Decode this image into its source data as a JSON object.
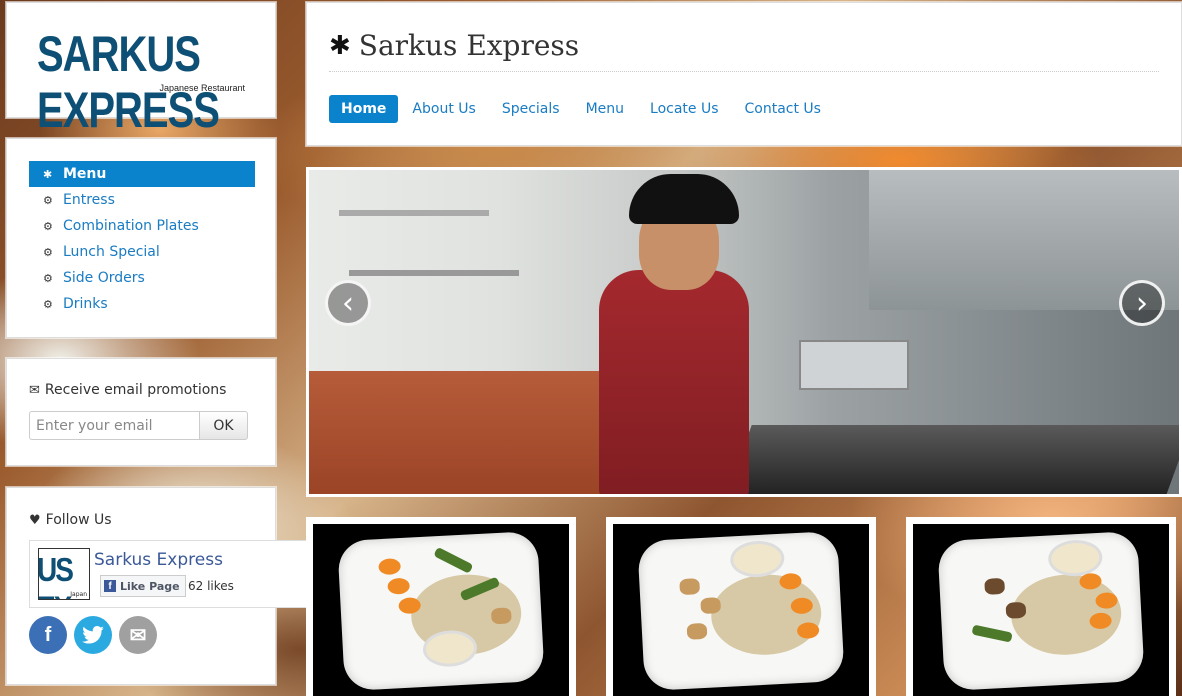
{
  "brand": {
    "logo_text": "SARKUS EXPRESS",
    "logo_subtitle": "Japanese Restaurant",
    "site_title": "Sarkus Express"
  },
  "nav": {
    "items": [
      {
        "label": "Home",
        "active": true
      },
      {
        "label": "About Us"
      },
      {
        "label": "Specials"
      },
      {
        "label": "Menu"
      },
      {
        "label": "Locate Us"
      },
      {
        "label": "Contact Us"
      }
    ]
  },
  "sidebar_menu": {
    "items": [
      {
        "label": "Menu",
        "icon": "asterisk-icon",
        "active": true
      },
      {
        "label": "Entress",
        "icon": "gear-icon"
      },
      {
        "label": "Combination Plates",
        "icon": "gear-icon"
      },
      {
        "label": "Lunch Special",
        "icon": "gear-icon"
      },
      {
        "label": "Side Orders",
        "icon": "gear-icon"
      },
      {
        "label": "Drinks",
        "icon": "gear-icon"
      }
    ]
  },
  "email": {
    "heading": "Receive email promotions",
    "placeholder": "Enter your email",
    "button_label": "OK"
  },
  "follow": {
    "heading": "Follow Us",
    "facebook": {
      "page_name": "Sarkus Express",
      "thumb_text": "US EX",
      "thumb_sub": "Japan",
      "like_label": "Like Page",
      "like_count": "62 likes"
    },
    "social": [
      "facebook-icon",
      "twitter-icon",
      "email-icon"
    ]
  },
  "slider": {
    "prev_icon": "chevron-left-icon",
    "next_icon": "chevron-right-icon"
  },
  "colors": {
    "accent": "#0a83cc",
    "link": "#1a7cc2",
    "logo": "#0d4f75"
  }
}
